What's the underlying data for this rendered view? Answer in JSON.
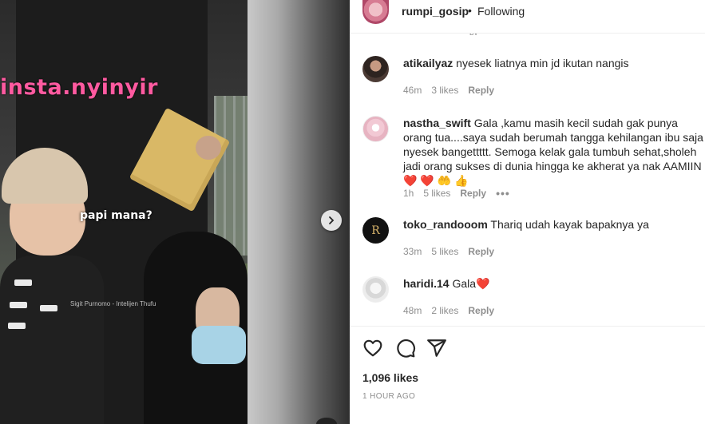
{
  "post": {
    "watermark": "insta.nyinyir",
    "caption": "papi mana?",
    "credit": "Sigit Purnomo - Intelijen Thufu"
  },
  "header": {
    "username": "rumpi_gosip",
    "separator": "•",
    "follow_status": "Following",
    "peek_text": "py"
  },
  "comments": [
    {
      "username": "atikailyaz",
      "text": "nyesek liatnya min jd ikutan nangis",
      "time": "46m",
      "likes": "3 likes",
      "reply": "Reply"
    },
    {
      "username": "nastha_swift",
      "text": "Gala ,kamu masih kecil sudah gak punya orang tua....saya sudah berumah tangga kehilangan ibu saja nyesek bangettttt. Semoga kelak gala tumbuh sehat,sholeh jadi orang sukses di dunia hingga ke akherat ya nak AAMIIN",
      "emoji": "❤️ ❤️ 🤲 👍",
      "time": "1h",
      "likes": "5 likes",
      "reply": "Reply",
      "more": "•••"
    },
    {
      "username": "toko_randooom",
      "text": "Thariq udah kayak bapaknya ya",
      "avatar_letter": "R",
      "time": "33m",
      "likes": "5 likes",
      "reply": "Reply"
    },
    {
      "username": "haridi.14",
      "text": "Gala",
      "emoji": "❤️",
      "time": "48m",
      "likes": "2 likes",
      "reply": "Reply"
    }
  ],
  "footer": {
    "likes": "1,096 likes",
    "timestamp": "1 HOUR AGO"
  },
  "icons": [
    "heart-icon",
    "comment-icon",
    "share-icon",
    "chevron-right-icon"
  ],
  "colors": {
    "accent_red": "#ed4956",
    "text": "#262626",
    "muted": "#8e8e8e",
    "watermark": "#ff5aa0"
  }
}
